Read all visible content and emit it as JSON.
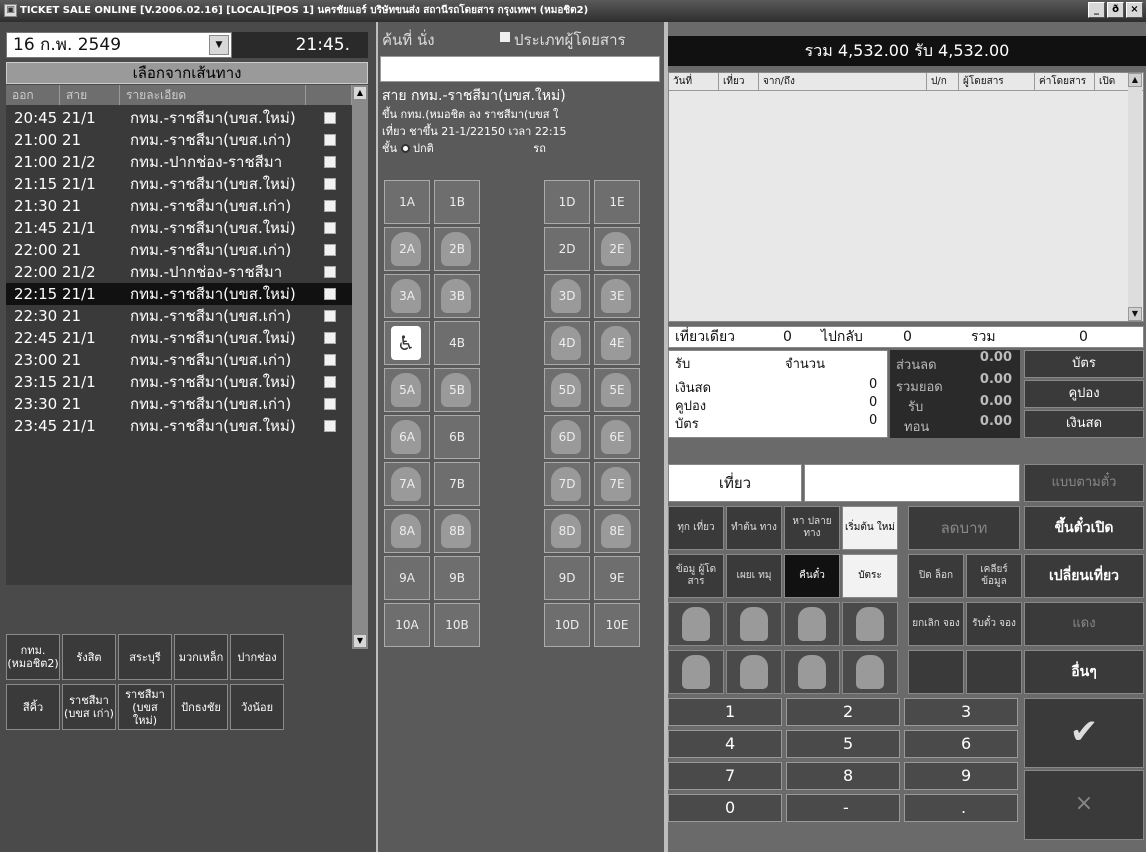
{
  "window": {
    "title": "TICKET SALE ONLINE [V.2006.02.16] [LOCAL][POS 1] นครชัยแอร์ บริษัทขนส่ง สถานีรถโดยสาร กรุงเทพฯ (หมอชิต2)",
    "minimize": "_",
    "restore": "ð",
    "close": "×"
  },
  "left_panel": {
    "date": "16 ก.พ.  2549",
    "time": "21:45.",
    "route_header": "เลือกจากเส้นทาง",
    "columns": {
      "time": "ออก",
      "line": "สาย",
      "detail": "รายละเอียด"
    },
    "trips": [
      {
        "time": "20:45",
        "line": "21/1",
        "detail": "กทม.-ราชสีมา(บขส.ใหม่)"
      },
      {
        "time": "21:00",
        "line": "21",
        "detail": "กทม.-ราชสีมา(บขส.เก่า)"
      },
      {
        "time": "21:00",
        "line": "21/2",
        "detail": "กทม.-ปากช่อง-ราชสีมา"
      },
      {
        "time": "21:15",
        "line": "21/1",
        "detail": "กทม.-ราชสีมา(บขส.ใหม่)"
      },
      {
        "time": "21:30",
        "line": "21",
        "detail": "กทม.-ราชสีมา(บขส.เก่า)"
      },
      {
        "time": "21:45",
        "line": "21/1",
        "detail": "กทม.-ราชสีมา(บขส.ใหม่)"
      },
      {
        "time": "22:00",
        "line": "21",
        "detail": "กทม.-ราชสีมา(บขส.เก่า)"
      },
      {
        "time": "22:00",
        "line": "21/2",
        "detail": "กทม.-ปากช่อง-ราชสีมา"
      },
      {
        "time": "22:15",
        "line": "21/1",
        "detail": "กทม.-ราชสีมา(บขส.ใหม่)"
      },
      {
        "time": "22:30",
        "line": "21",
        "detail": "กทม.-ราชสีมา(บขส.เก่า)"
      },
      {
        "time": "22:45",
        "line": "21/1",
        "detail": "กทม.-ราชสีมา(บขส.ใหม่)"
      },
      {
        "time": "23:00",
        "line": "21",
        "detail": "กทม.-ราชสีมา(บขส.เก่า)"
      },
      {
        "time": "23:15",
        "line": "21/1",
        "detail": "กทม.-ราชสีมา(บขส.ใหม่)"
      },
      {
        "time": "23:30",
        "line": "21",
        "detail": "กทม.-ราชสีมา(บขส.เก่า)"
      },
      {
        "time": "23:45",
        "line": "21/1",
        "detail": "กทม.-ราชสีมา(บขส.ใหม่)"
      }
    ],
    "selected_trip": "22:15",
    "destinations": [
      "กทม. (หมอชิต2)",
      "รังสิต",
      "สระบุรี",
      "มวกเหล็ก",
      "ปากช่อง",
      "สีคิ้ว",
      "ราชสีมา (บขส เก่า)",
      "ราชสีมา (บขส ใหม่)",
      "ปักธงชัย",
      "วังน้อย"
    ]
  },
  "middle_panel": {
    "search_label": "ค้นที่  นั่ง",
    "passenger_type_label": "ประเภทผู้โดยสาร",
    "route_title": "สาย  กทม.-ราชสีมา(บขส.ใหม่)",
    "route_board": "ขึ้น กทม.(หมอชิต   ลง ราชสีมา(บขส ใ",
    "route_trip": "เที่ยว ชาขึ้น  21-1/22150  เวลา 22:15",
    "route_class_label": "ชั้น",
    "route_class_value": "ปกติ",
    "route_class_suffix": "รถ",
    "seats": [
      {
        "label": "1A",
        "state": "free"
      },
      {
        "label": "1B",
        "state": "free"
      },
      {
        "label": "1D",
        "state": "free"
      },
      {
        "label": "1E",
        "state": "free"
      },
      {
        "label": "2A",
        "state": "taken"
      },
      {
        "label": "2B",
        "state": "taken"
      },
      {
        "label": "2D",
        "state": "free"
      },
      {
        "label": "2E",
        "state": "taken"
      },
      {
        "label": "3A",
        "state": "taken"
      },
      {
        "label": "3B",
        "state": "taken"
      },
      {
        "label": "3D",
        "state": "taken"
      },
      {
        "label": "3E",
        "state": "taken"
      },
      {
        "label": "4A",
        "state": "wheelchair"
      },
      {
        "label": "4B",
        "state": "free"
      },
      {
        "label": "4D",
        "state": "taken"
      },
      {
        "label": "4E",
        "state": "taken"
      },
      {
        "label": "5A",
        "state": "taken"
      },
      {
        "label": "5B",
        "state": "taken"
      },
      {
        "label": "5D",
        "state": "taken"
      },
      {
        "label": "5E",
        "state": "taken"
      },
      {
        "label": "6A",
        "state": "taken"
      },
      {
        "label": "6B",
        "state": "free"
      },
      {
        "label": "6D",
        "state": "taken"
      },
      {
        "label": "6E",
        "state": "taken"
      },
      {
        "label": "7A",
        "state": "taken"
      },
      {
        "label": "7B",
        "state": "free"
      },
      {
        "label": "7D",
        "state": "taken"
      },
      {
        "label": "7E",
        "state": "taken"
      },
      {
        "label": "8A",
        "state": "taken"
      },
      {
        "label": "8B",
        "state": "taken"
      },
      {
        "label": "8D",
        "state": "taken"
      },
      {
        "label": "8E",
        "state": "taken"
      },
      {
        "label": "9A",
        "state": "free"
      },
      {
        "label": "9B",
        "state": "free"
      },
      {
        "label": "9D",
        "state": "free"
      },
      {
        "label": "9E",
        "state": "free"
      },
      {
        "label": "10A",
        "state": "free"
      },
      {
        "label": "10B",
        "state": "free"
      },
      {
        "label": "10D",
        "state": "free"
      },
      {
        "label": "10E",
        "state": "free"
      }
    ]
  },
  "right_panel": {
    "total_bar": "รวม 4,532.00 รับ 4,532.00",
    "ticket_columns": [
      "วันที่",
      "เที่ยว",
      "จาก/ถึง",
      "ป/ก",
      "ผู้โดยสาร",
      "ค่าโดยสาร",
      "เปิด"
    ],
    "one_way_label": "เที่ยวเดียว",
    "one_way_count": "0",
    "round_trip_label": "ไปกลับ",
    "round_trip_count": "0",
    "total_label": "รวม",
    "total_count": "0",
    "pay_receive_label": "รับ",
    "pay_amount_label": "จำนวน",
    "cash_label": "เงินสด",
    "cash_count": "0",
    "coupon_label": "คูปอง",
    "coupon_count": "0",
    "card_label": "บัตร",
    "card_count": "0",
    "discount_label": "ส่วนลด",
    "discount_value": "0.00",
    "grand_total_label": "รวมยอด",
    "grand_total_value": "0.00",
    "received_label": "รับ",
    "received_value": "0.00",
    "change_label": "ทอน",
    "change_value": "0.00",
    "card_button": "บัตร",
    "coupon_button": "คูปอง",
    "cash_button": "เงินสด",
    "trip_label": "เที่ยว",
    "route_tickets_button": "แบบตามตั๋ว",
    "func_buttons": [
      {
        "label": "ทุก เที่ยว",
        "style": "normal"
      },
      {
        "label": "ทำต้น ทาง",
        "style": "normal"
      },
      {
        "label": "หา ปลาย ทาง",
        "style": "normal"
      },
      {
        "label": "เริ่มต้น ใหม่",
        "style": "white"
      },
      {
        "label": "ข้อมู ผู้โด สาร",
        "style": "normal"
      },
      {
        "label": "เผยเ ทมุ",
        "style": "normal"
      },
      {
        "label": "คืนตั๋ว",
        "style": "dark"
      },
      {
        "label": "บัตระ",
        "style": "white"
      },
      {
        "label": "ปิด ล็อก",
        "style": "normal"
      },
      {
        "label": "เคลียร์ ข้อมูล",
        "style": "normal"
      }
    ],
    "discount_button": "ลดบาท",
    "cancel_reserve": "ยกเลิก จอง",
    "receive_reserve": "รับตั๋ว จอง",
    "side_buttons": [
      "ขึ้นตั๋วเปิด",
      "เปลี่ยนเที่ยว",
      "แดง",
      "อื่นๆ"
    ],
    "numpad": [
      "1",
      "2",
      "3",
      "4",
      "5",
      "6",
      "7",
      "8",
      "9",
      "0",
      "-",
      "."
    ],
    "ok_button": "✔",
    "cancel_button": "×"
  }
}
